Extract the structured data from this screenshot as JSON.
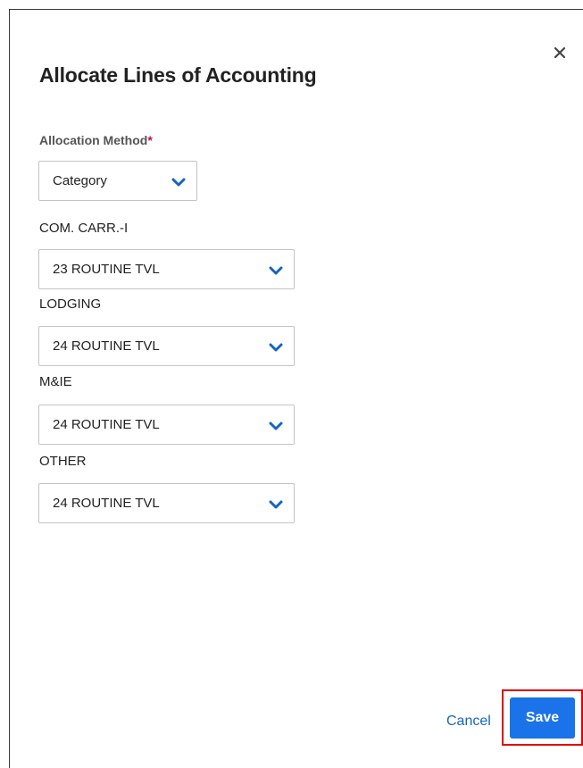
{
  "dialog": {
    "title": "Allocate Lines of Accounting",
    "close_icon": "close-icon"
  },
  "allocation_method": {
    "label": "Allocation Method",
    "required_marker": "*",
    "value": "Category"
  },
  "categories": [
    {
      "label": "COM. CARR.-I",
      "value": "23 ROUTINE TVL"
    },
    {
      "label": "LODGING",
      "value": "24 ROUTINE TVL"
    },
    {
      "label": "M&IE",
      "value": "24 ROUTINE TVL"
    },
    {
      "label": "OTHER",
      "value": "24 ROUTINE TVL"
    }
  ],
  "footer": {
    "cancel_label": "Cancel",
    "save_label": "Save"
  },
  "colors": {
    "accent": "#1a73e8",
    "chevron": "#1565c0",
    "highlight": "#e00000",
    "required": "#c8102e"
  }
}
